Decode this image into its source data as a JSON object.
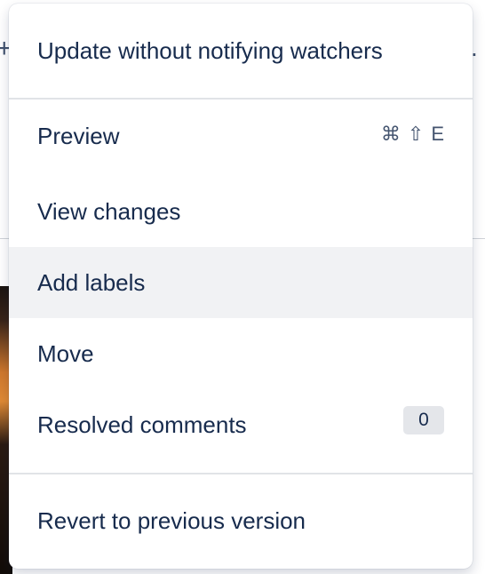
{
  "background": {
    "left_glyph": "+",
    "right_glyph": "."
  },
  "menu": {
    "section1": {
      "items": [
        {
          "label": "Update without notifying watchers"
        }
      ]
    },
    "section2": {
      "items": [
        {
          "label": "Preview",
          "shortcut": [
            "⌘",
            "⇧",
            "E"
          ]
        },
        {
          "label": "View changes"
        },
        {
          "label": "Add labels",
          "hovered": true
        },
        {
          "label": "Move"
        },
        {
          "label": "Resolved comments",
          "badge": "0"
        }
      ]
    },
    "section3": {
      "items": [
        {
          "label": "Revert to previous version"
        }
      ]
    }
  },
  "colors": {
    "text": "#172b4d",
    "hover": "#f1f2f4",
    "badge_bg": "#e4e6ea",
    "divider": "#e1e3e7"
  }
}
